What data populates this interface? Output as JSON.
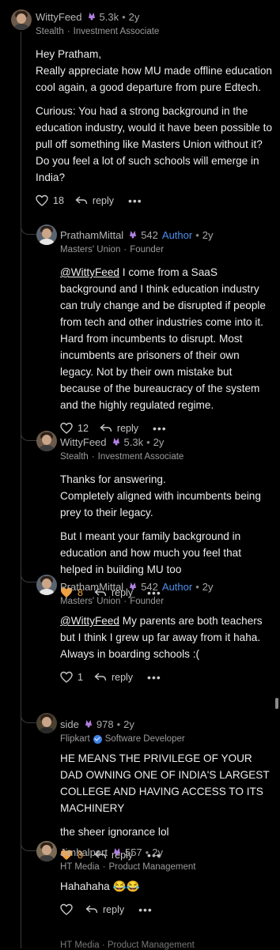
{
  "comments": [
    {
      "name": "WittyFeed",
      "karma": "5.3k",
      "age": "2y",
      "company": "Stealth",
      "role": "Investment Associate",
      "paras": [
        "Hey Pratham,\nReally appreciate how MU made offline education cool again, a good departure from pure Edtech.",
        "Curious: You had a strong background in the education industry, would it have been possible to pull off something like Masters Union without it?\nDo you feel a lot of such schools will emerge in India?"
      ],
      "likes": "18",
      "reply_label": "reply",
      "more_label": "•••"
    },
    {
      "name": "PrathamMittal",
      "karma": "542",
      "author_badge": "Author",
      "age": "2y",
      "company": "Masters' Union",
      "role": "Founder",
      "mention": "@WittyFeed",
      "text": " I come from a SaaS background and I think education industry can truly change and be disrupted if people from tech and other industries come into it. Hard from incumbents to disrupt. Most incumbents are prisoners of their own legacy. Not by their own mistake but because of the bureaucracy of the system and the highly regulated regime.",
      "likes": "12",
      "reply_label": "reply",
      "more_label": "•••"
    },
    {
      "name": "WittyFeed",
      "karma": "5.3k",
      "age": "2y",
      "company": "Stealth",
      "role": "Investment Associate",
      "paras": [
        "Thanks for answering.\nCompletely aligned with incumbents being prey to their legacy.",
        "But I meant your family background in education and how much you feel that helped in building MU too"
      ],
      "likes": "8",
      "reply_label": "reply",
      "more_label": "•••"
    },
    {
      "name": "PrathamMittal",
      "karma": "542",
      "author_badge": "Author",
      "age": "2y",
      "company": "Masters' Union",
      "role": "Founder",
      "mention": "@WittyFeed",
      "text": " My parents are both teachers but I think I grew up far away from it haha. Always in boarding schools :(",
      "likes": "1",
      "reply_label": "reply",
      "more_label": "•••"
    },
    {
      "name": "side",
      "karma": "978",
      "age": "2y",
      "company": "Flipkart",
      "role": "Software Developer",
      "paras": [
        "HE MEANS THE PRIVILEGE OF YOUR DAD OWNING ONE OF INDIA'S LARGEST COLLEGE AND HAVING ACCESS TO ITS MACHINERY",
        "the sheer ignorance lol"
      ],
      "likes": "8",
      "reply_label": "reply",
      "more_label": "•••"
    },
    {
      "name": "Jimhalpert",
      "karma": "557",
      "age": "2y",
      "company": "HT Media",
      "role": "Product Management",
      "paras": [
        "Hahahaha 😂😂"
      ],
      "reply_label": "reply",
      "more_label": "•••"
    }
  ],
  "footer_cutoff": "HT Media · Product Management",
  "colors": {
    "background": "#000000",
    "liked": "#f0a040",
    "author": "#4b8fe8",
    "karma_icon": "#b07fe0"
  }
}
